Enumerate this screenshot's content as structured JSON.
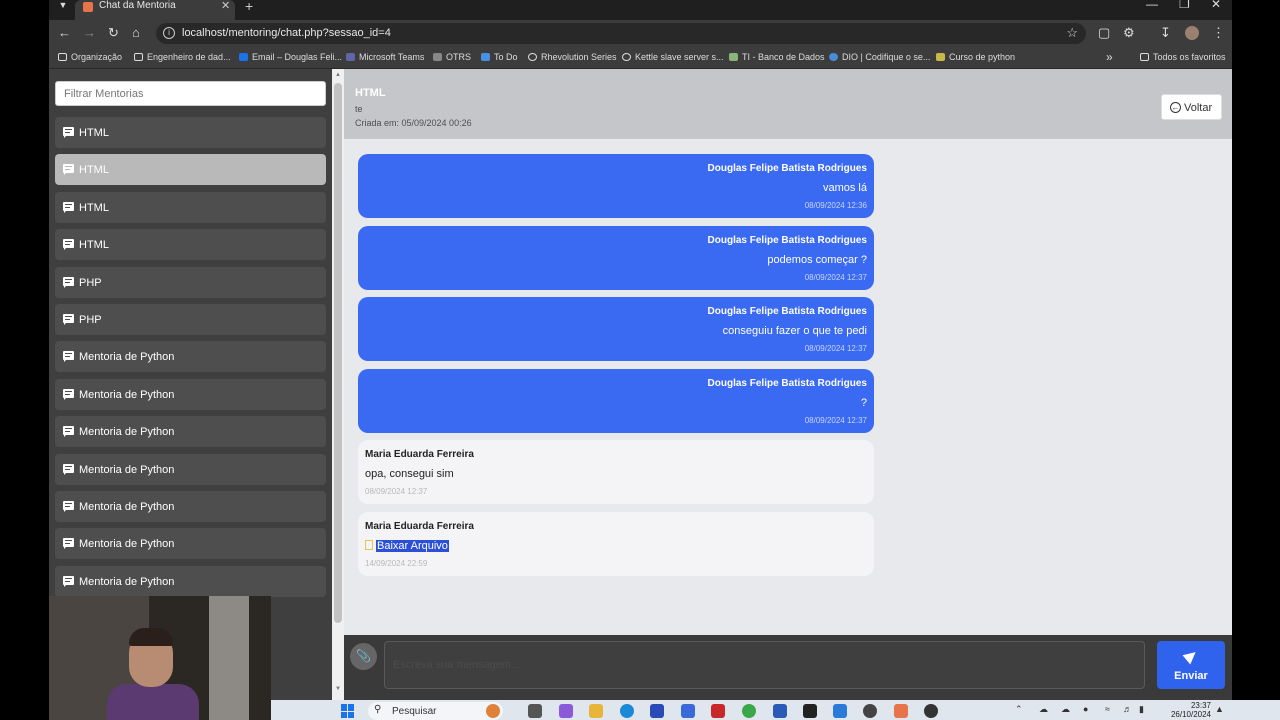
{
  "browser": {
    "tab_title": "Chat da Mentoria",
    "url": "localhost/mentoring/chat.php?sessao_id=4",
    "bookmarks": [
      {
        "label": "Organização",
        "icon": "folder-icon",
        "color": "#dddddd"
      },
      {
        "label": "Engenheiro de dad...",
        "icon": "folder-icon",
        "color": "#dddddd"
      },
      {
        "label": "Email – Douglas Feli...",
        "icon": "outlook-icon",
        "color": "#1a73e8"
      },
      {
        "label": "Microsoft Teams",
        "icon": "teams-icon",
        "color": "#6264a7"
      },
      {
        "label": "OTRS",
        "icon": "otrs-icon",
        "color": "#aaaaaa"
      },
      {
        "label": "To Do",
        "icon": "todo-icon",
        "color": "#4a90e2"
      },
      {
        "label": "Rhevolution Series",
        "icon": "globe-icon",
        "color": "#dddddd"
      },
      {
        "label": "Kettle slave server s...",
        "icon": "globe-icon",
        "color": "#dddddd"
      },
      {
        "label": "TI - Banco de Dados",
        "icon": "ti-icon",
        "color": "#8ab47a"
      },
      {
        "label": "DIO | Codifique o se...",
        "icon": "dio-icon",
        "color": "#4a8ad8"
      },
      {
        "label": "Curso de python",
        "icon": "python-icon",
        "color": "#c8b84a"
      }
    ],
    "all_bookmarks": "Todos os favoritos"
  },
  "sidebar": {
    "filter_placeholder": "Filtrar Mentorias",
    "items": [
      {
        "label": "HTML",
        "active": false
      },
      {
        "label": "HTML",
        "active": true
      },
      {
        "label": "HTML",
        "active": false
      },
      {
        "label": "HTML",
        "active": false
      },
      {
        "label": "PHP",
        "active": false
      },
      {
        "label": "PHP",
        "active": false
      },
      {
        "label": "Mentoria de Python",
        "active": false
      },
      {
        "label": "Mentoria de Python",
        "active": false
      },
      {
        "label": "Mentoria de Python",
        "active": false
      },
      {
        "label": "Mentoria de Python",
        "active": false
      },
      {
        "label": "Mentoria de Python",
        "active": false
      },
      {
        "label": "Mentoria de Python",
        "active": false
      },
      {
        "label": "Mentoria de Python",
        "active": false
      }
    ]
  },
  "header": {
    "title": "HTML",
    "subtitle": "te",
    "created": "Criada em: 05/09/2024 00:26",
    "back_label": "Voltar"
  },
  "messages": [
    {
      "author": "Douglas Felipe Batista Rodrigues",
      "text": "vamos lá",
      "time": "08/09/2024 12:36",
      "mine": true
    },
    {
      "author": "Douglas Felipe Batista Rodrigues",
      "text": "podemos começar ?",
      "time": "08/09/2024 12:37",
      "mine": true
    },
    {
      "author": "Douglas Felipe Batista Rodrigues",
      "text": "conseguiu fazer o que te pedi",
      "time": "08/09/2024 12:37",
      "mine": true
    },
    {
      "author": "Douglas Felipe Batista Rodrigues",
      "text": "?",
      "time": "08/09/2024 12:37",
      "mine": true
    },
    {
      "author": "Maria Eduarda Ferreira",
      "text": "opa, consegui sim",
      "time": "08/09/2024 12:37",
      "mine": false
    },
    {
      "author": "Maria Eduarda Ferreira",
      "text": "Baixar Arquivo",
      "time": "14/09/2024 22:59",
      "mine": false,
      "file": true
    }
  ],
  "composer": {
    "placeholder": "Escreva sua mensagem...",
    "send_label": "Enviar"
  },
  "taskbar": {
    "search_label": "Pesquisar",
    "time": "23:37",
    "date": "26/10/2024"
  },
  "colors": {
    "accent": "#3b6af2",
    "sidebar_bg": "#3f3f3f",
    "page_bg": "#e7e9ec"
  }
}
